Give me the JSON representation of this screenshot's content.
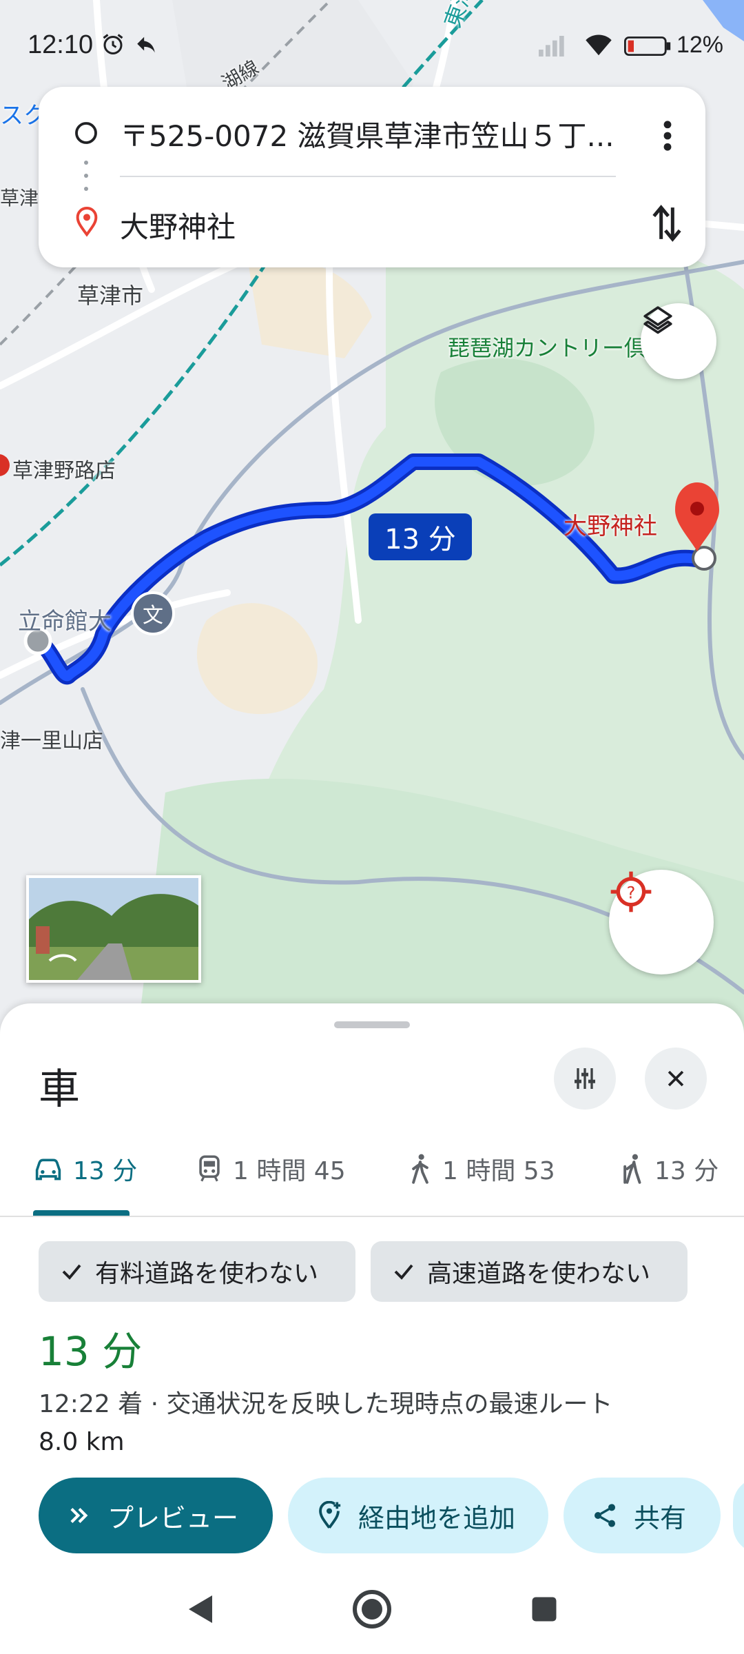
{
  "status_bar": {
    "time": "12:10",
    "battery_percent": "12%"
  },
  "directions": {
    "origin": "〒525-0072 滋賀県草津市笠山５丁...",
    "destination": "大野神社"
  },
  "map": {
    "labels": {
      "kusatsu_city": "草津市",
      "kusatsu_left": "草津",
      "tokaido_line": "東海道",
      "kosei_line": "湖線",
      "country_club": "琵琶湖カントリー倶楽部",
      "kusatsu_nojiten": "草津野路店",
      "ritsumeikan": "立命館大",
      "ichiriyama": "津一里山店",
      "destination_pin": "大野神社",
      "left_edge": "スク"
    },
    "route_duration_label": "13 分",
    "school_icon_glyph": "文"
  },
  "sheet": {
    "mode_title": "車",
    "tabs": [
      {
        "label": "13 分",
        "icon": "car-icon"
      },
      {
        "label": "1 時間 45",
        "icon": "train-icon"
      },
      {
        "label": "1 時間 53",
        "icon": "walk-icon"
      },
      {
        "label": "13 分",
        "icon": "rideshare-icon"
      }
    ],
    "chips": [
      "有料道路を使わない",
      "高速道路を使わない"
    ],
    "route": {
      "duration": "13 分",
      "meta": "12:22 着 · 交通状況を反映した現時点の最速ルート",
      "distance": "8.0 km"
    },
    "actions": {
      "preview": "プレビュー",
      "add_stop": "経由地を追加",
      "share": "共有"
    }
  },
  "colors": {
    "route": "#1a3fe0",
    "accent": "#0b6e82",
    "duration_green": "#188038",
    "pin": "#ea4335"
  }
}
